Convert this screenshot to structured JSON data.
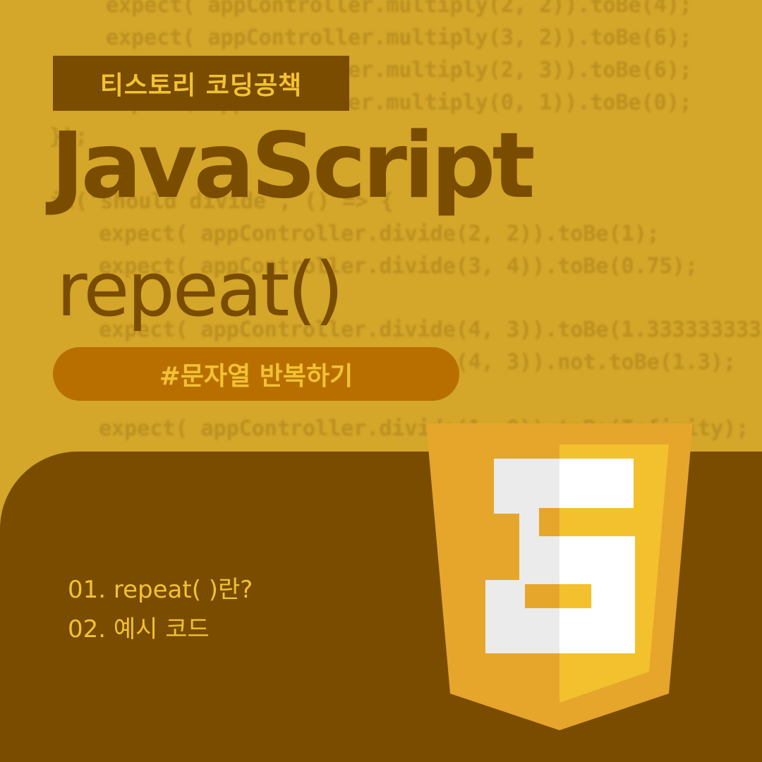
{
  "background_code": [
    "expect( appController.multiply(2, 2)).toBe(4);",
    "expect( appController.multiply(3, 2)).toBe(6);",
    "expect( appController.multiply(2, 3)).toBe(6);",
    "expect( appController.multiply(0, 1)).toBe(0);",
    "});",
    "it('should divide', () => {",
    "expect( appController.divide(2, 2)).toBe(1);",
    "expect( appController.divide(3, 4)).toBe(0.75);",
    "expect( appController.divide(4, 3)).toBe(1.3333333333333333);",
    "expect( appController.divide(4, 3)).not.toBe(1.3);",
    "expect( appController.divide(1, 0)).toBe(Infinity);"
  ],
  "badge": {
    "label": "티스토리 코딩공책"
  },
  "title": "JavaScript",
  "subtitle": "repeat()",
  "hashtag": "#문자열 반복하기",
  "toc": [
    "01. repeat( )란?",
    "02. 예시 코드"
  ],
  "logo": {
    "icon": "html5-shield-icon",
    "colors": {
      "shield_outer": "#e6a52b",
      "shield_inner": "#f2c12d",
      "glyph_left": "#ebebeb",
      "glyph_right": "#ffffff"
    }
  },
  "colors": {
    "background": "#d4a629",
    "panel": "#7a4c00",
    "accent_text": "#f1c233",
    "pill": "#b86f00"
  }
}
